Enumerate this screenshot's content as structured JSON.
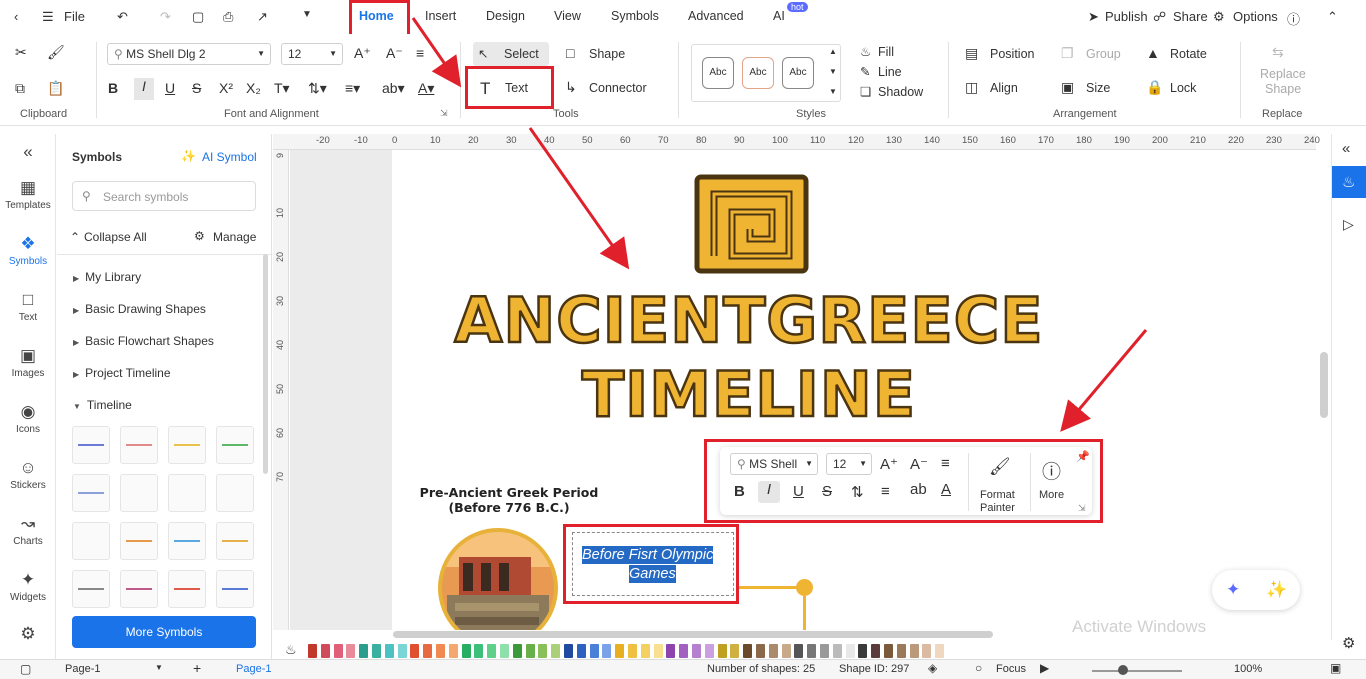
{
  "topbar": {
    "file_label": "File",
    "tabs": [
      "Home",
      "Insert",
      "Design",
      "View",
      "Symbols",
      "Advanced",
      "AI"
    ],
    "hot_badge": "hot",
    "publish_label": "Publish",
    "share_label": "Share",
    "options_label": "Options"
  },
  "ribbon": {
    "font_name": "MS Shell Dlg 2",
    "font_size": "12",
    "select_label": "Select",
    "shape_label": "Shape",
    "text_label": "Text",
    "connector_label": "Connector",
    "style_samples": [
      "Abc",
      "Abc",
      "Abc"
    ],
    "fill_label": "Fill",
    "line_label": "Line",
    "shadow_label": "Shadow",
    "position_label": "Position",
    "group_label": "Group",
    "rotate_label": "Rotate",
    "align_label": "Align",
    "size_label": "Size",
    "lock_label": "Lock",
    "replace_shape_line1": "Replace",
    "replace_shape_line2": "Shape",
    "groups": {
      "clipboard": "Clipboard",
      "font": "Font and Alignment",
      "tools": "Tools",
      "styles": "Styles",
      "arrangement": "Arrangement",
      "replace": "Replace"
    }
  },
  "leftbar": {
    "items": [
      "Templates",
      "Symbols",
      "Text",
      "Images",
      "Icons",
      "Stickers",
      "Charts",
      "Widgets"
    ]
  },
  "panel": {
    "title": "Symbols",
    "ai_symbol": "AI Symbol",
    "search_placeholder": "Search symbols",
    "collapse_all": "Collapse All",
    "manage": "Manage",
    "sections": [
      "My Library",
      "Basic Drawing Shapes",
      "Basic Flowchart Shapes",
      "Project Timeline",
      "Timeline"
    ],
    "more_symbols": "More Symbols"
  },
  "ruler": {
    "h_ticks": [
      "-20",
      "-10",
      "0",
      "10",
      "20",
      "30",
      "40",
      "50",
      "60",
      "70",
      "80",
      "90",
      "100",
      "110",
      "120",
      "130",
      "140",
      "150",
      "160",
      "170",
      "180",
      "190",
      "200",
      "210",
      "220",
      "230",
      "240"
    ],
    "v_ticks": [
      "9",
      "10",
      "20",
      "30",
      "40",
      "50",
      "60",
      "70"
    ]
  },
  "canvas": {
    "title_line1": "ANCIENTGREECE",
    "title_line2": "TIMELINE",
    "period_line1": "Pre-Ancient Greek Period",
    "period_line2": "(Before 776 B.C.)",
    "edit_text_line1": "Before Fisrt Olympic",
    "edit_text_line2": "Games"
  },
  "floatbar": {
    "font_name": "MS Shell",
    "font_size": "12",
    "format_painter_line1": "Format",
    "format_painter_line2": "Painter",
    "more_label": "More"
  },
  "bottombar": {
    "page_tab": "Page-1",
    "page_active": "Page-1",
    "shapes_count": "Number of shapes: 25",
    "shape_id": "Shape ID: 297",
    "focus_label": "Focus",
    "zoom": "100%"
  },
  "watermark": "Activate Windows",
  "colors": {
    "accent": "#1a73e8",
    "highlight": "#e0202a",
    "title_fill": "#f0b433"
  }
}
